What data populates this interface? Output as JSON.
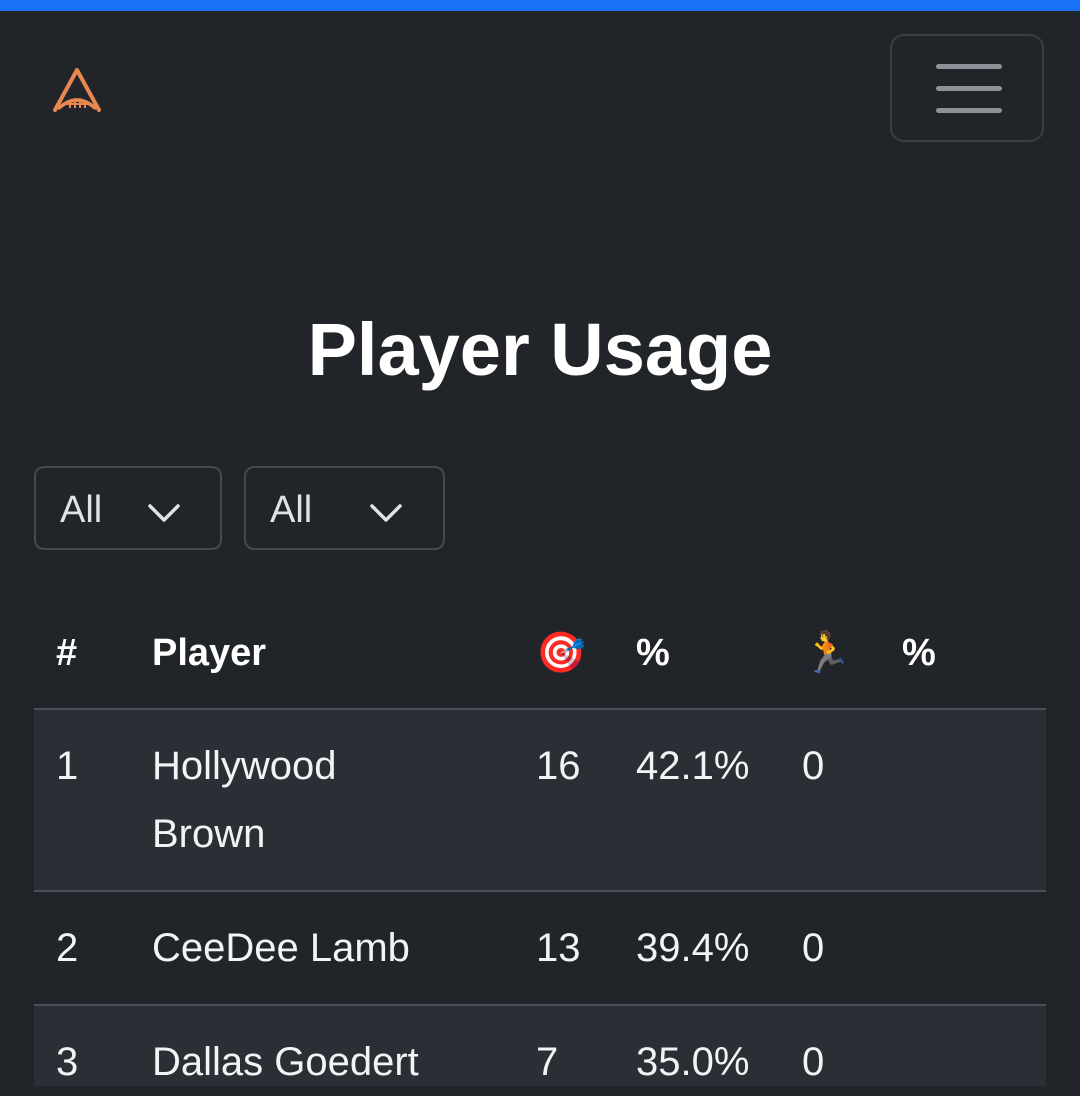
{
  "header": {
    "logo_icon": "football-arch-logo-icon",
    "menu_icon": "hamburger-menu-icon",
    "accent_color": "#1a73f5",
    "logo_color": "#e8874f"
  },
  "page": {
    "title": "Player Usage"
  },
  "filters": [
    {
      "value": "All"
    },
    {
      "value": "All"
    }
  ],
  "table": {
    "headers": {
      "rank": "#",
      "player": "Player",
      "targets_icon": "🎯",
      "targets_pct": "%",
      "carries_icon": "🏃",
      "carries_pct": "%"
    },
    "rows": [
      {
        "rank": "1",
        "player": "Hollywood Brown",
        "targets": "16",
        "targets_pct": "42.1%",
        "carries": "0",
        "carries_pct": ""
      },
      {
        "rank": "2",
        "player": "CeeDee Lamb",
        "targets": "13",
        "targets_pct": "39.4%",
        "carries": "0",
        "carries_pct": ""
      },
      {
        "rank": "3",
        "player": "Dallas Goedert",
        "targets": "7",
        "targets_pct": "35.0%",
        "carries": "0",
        "carries_pct": ""
      }
    ]
  }
}
